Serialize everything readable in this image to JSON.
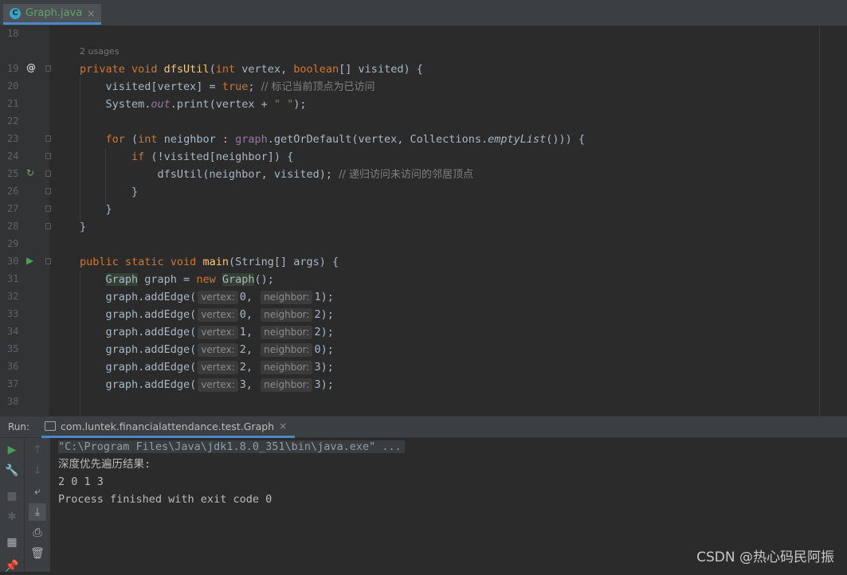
{
  "tab": {
    "label": "Graph.java",
    "close": "×",
    "icon_letter": "C"
  },
  "gutter": {
    "lines": [
      "18",
      "19",
      "20",
      "21",
      "22",
      "23",
      "24",
      "25",
      "26",
      "27",
      "28",
      "29",
      "30",
      "31",
      "32",
      "33",
      "34",
      "35",
      "36",
      "37",
      "38"
    ],
    "marker_at": "@"
  },
  "code": {
    "usages": "2 usages",
    "comment_line20": "// 标记当前顶点为已访问",
    "comment_line25": "// 递归访问未访问的邻居顶点",
    "hint_vertex": "vertex:",
    "hint_neighbor": "neighbor:",
    "edges": [
      {
        "a": "0",
        "b": "1"
      },
      {
        "a": "0",
        "b": "2"
      },
      {
        "a": "1",
        "b": "2"
      },
      {
        "a": "2",
        "b": "0"
      },
      {
        "a": "2",
        "b": "3"
      },
      {
        "a": "3",
        "b": "3"
      }
    ]
  },
  "run": {
    "label": "Run:",
    "tab_label": "com.luntek.financialattendance.test.Graph",
    "close": "×"
  },
  "console": {
    "command": "\"C:\\Program Files\\Java\\jdk1.8.0_351\\bin\\java.exe\" ...",
    "line1": "深度优先遍历结果:",
    "line2": "2 0 1 3",
    "line3": "Process finished with exit code 0"
  },
  "watermark": "CSDN @热心码民阿振"
}
